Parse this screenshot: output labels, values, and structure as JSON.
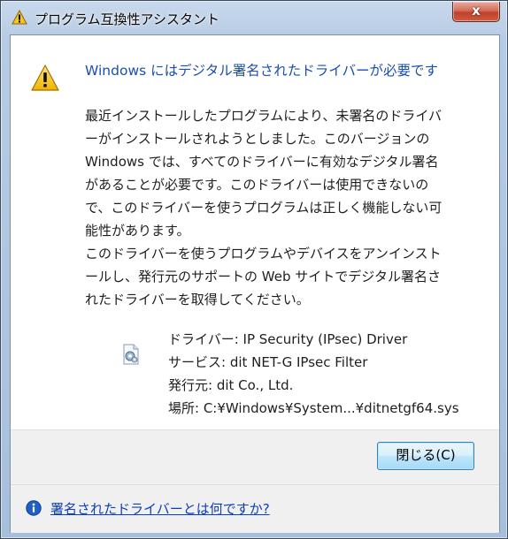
{
  "window": {
    "title": "プログラム互換性アシスタント",
    "close_glyph": "x"
  },
  "main": {
    "heading": "Windows にはデジタル署名されたドライバーが必要です",
    "paragraph1_lines": [
      "最近インストールしたプログラムにより、未署名のドライバ",
      "ーがインストールされようとしました。このバージョンの",
      "Windows では、すべてのドライバーに有効なデジタル署名",
      "があることが必要です。このドライバーは使用できないの",
      "で、このドライバーを使うプログラムは正しく機能しない可",
      "能性があります。"
    ],
    "paragraph2_lines": [
      "このドライバーを使うプログラムやデバイスをアンインスト",
      "ールし、発行元のサポートの Web サイトでデジタル署名さ",
      "れたドライバーを取得してください。"
    ],
    "details": {
      "driver": "ドライバー: IP Security (IPsec) Driver",
      "service": "サービス: dit NET-G IPsec Filter",
      "publisher": "発行元: dit Co., Ltd.",
      "location": "場所: C:¥Windows¥System...¥ditnetgf64.sys"
    }
  },
  "buttons": {
    "close_label": "閉じる(C)"
  },
  "footer": {
    "help_link": "署名されたドライバーとは何ですか?"
  },
  "icons": {
    "title": "warning-icon",
    "main": "warning-icon",
    "driver": "driver-file-icon",
    "footer": "info-icon"
  }
}
